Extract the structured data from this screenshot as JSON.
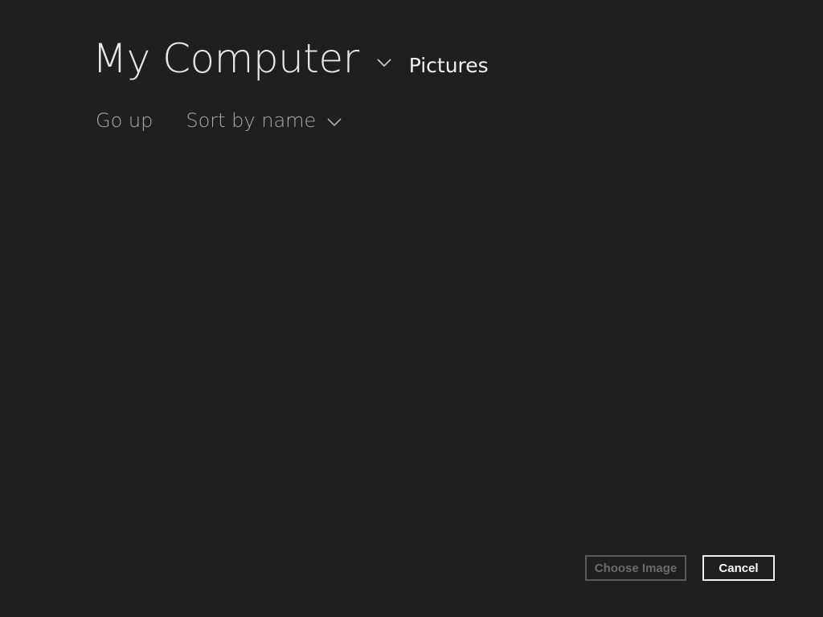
{
  "header": {
    "location_title": "My Computer",
    "subfolder": "Pictures"
  },
  "toolbar": {
    "go_up_label": "Go up",
    "sort_label": "Sort by name"
  },
  "file_list": {
    "items": []
  },
  "footer": {
    "choose_label": "Choose Image",
    "cancel_label": "Cancel",
    "choose_enabled": false
  },
  "icons": {
    "location_dropdown": "chevron-down-icon",
    "sort_dropdown": "chevron-down-icon"
  },
  "colors": {
    "background": "#1f1f1f",
    "title_text": "#e6e6e6",
    "toolbar_text": "#a9a9a9",
    "disabled_button": "#5a5a5a",
    "button_border": "#f0f0f0"
  }
}
